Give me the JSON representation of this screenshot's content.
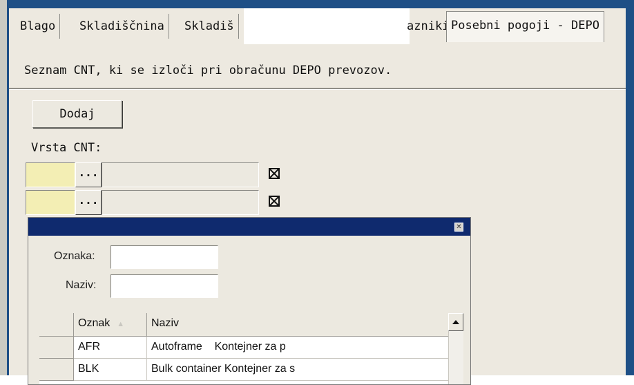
{
  "tabs": [
    {
      "label": "Blago"
    },
    {
      "label": "Skladiščnina"
    },
    {
      "label": "Skladiš"
    },
    {
      "label": "azniki"
    },
    {
      "label": "Posebni pogoji - DEPO"
    }
  ],
  "description": "Seznam CNT, ki se izloči pri obračunu DEPO prevozov.",
  "add_button_label": "Dodaj",
  "vrsta_label": "Vrsta CNT:",
  "rows": [
    {
      "code": "",
      "name": "",
      "lookup": "...",
      "checked": true
    },
    {
      "code": "",
      "name": "",
      "lookup": "...",
      "checked": true
    }
  ],
  "popup": {
    "oznaka_label": "Oznaka:",
    "naziv_label": "Naziv:",
    "oznaka_value": "",
    "naziv_value": "",
    "columns": [
      "Oznak",
      "Naziv"
    ],
    "items": [
      {
        "code": "AFR",
        "name": "Autoframe",
        "desc": "Kontejner za p"
      },
      {
        "code": "BLK",
        "name": "Bulk container",
        "desc": "Kontejner za s"
      }
    ]
  }
}
